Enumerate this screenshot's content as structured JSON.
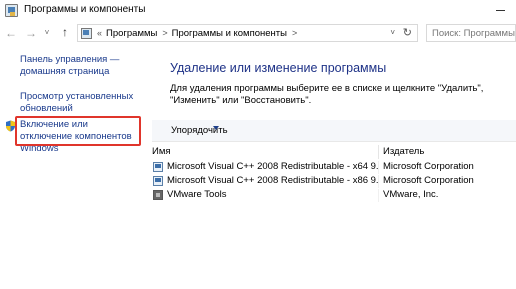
{
  "window": {
    "title": "Программы и компоненты"
  },
  "address_bar": {
    "prefix": "«",
    "crumbs": [
      "Программы",
      "Программы и компоненты"
    ],
    "separator": ">"
  },
  "search": {
    "placeholder": "Поиск: Программы и к..."
  },
  "sidebar": {
    "items": [
      {
        "label": "Панель управления — домашняя страница"
      },
      {
        "label": "Просмотр установленных обновлений"
      },
      {
        "label": "Включение или отключение компонентов Windows",
        "highlighted": true,
        "icon": "shield-icon"
      }
    ]
  },
  "main": {
    "title": "Удаление или изменение программы",
    "description": "Для удаления программы выберите ее в списке и щелкните \"Удалить\", \"Изменить\" или \"Восстановить\"."
  },
  "toolbar": {
    "organize_label": "Упорядочить"
  },
  "table": {
    "columns": [
      "Имя",
      "Издатель"
    ],
    "rows": [
      {
        "name": "Microsoft Visual C++ 2008 Redistributable - x64 9.0.3...",
        "publisher": "Microsoft Corporation",
        "icon": "installer-icon"
      },
      {
        "name": "Microsoft Visual C++ 2008 Redistributable - x86 9.0.3...",
        "publisher": "Microsoft Corporation",
        "icon": "installer-icon"
      },
      {
        "name": "VMware Tools",
        "publisher": "VMware, Inc.",
        "icon": "vmware-icon"
      }
    ]
  },
  "colors": {
    "link": "#1a3a8c",
    "heading": "#1e3287",
    "highlight_border": "#e0352b"
  }
}
